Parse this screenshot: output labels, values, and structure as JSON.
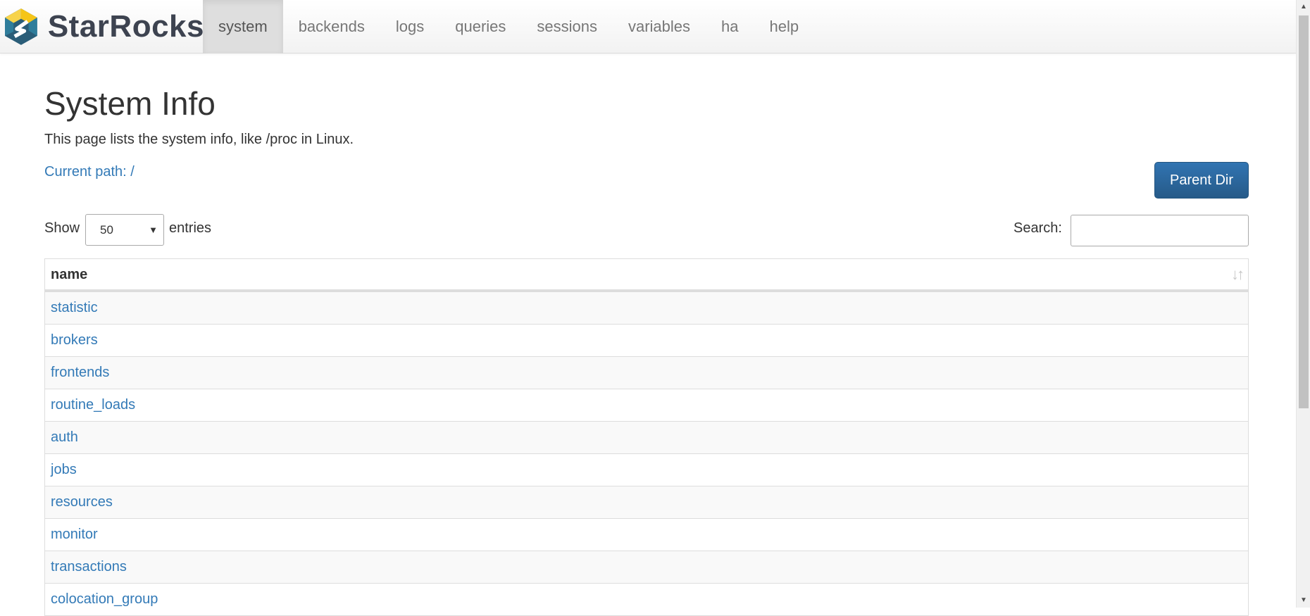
{
  "brand": {
    "name": "StarRocks"
  },
  "nav": {
    "items": [
      {
        "label": "system",
        "active": true
      },
      {
        "label": "backends"
      },
      {
        "label": "logs"
      },
      {
        "label": "queries"
      },
      {
        "label": "sessions"
      },
      {
        "label": "variables"
      },
      {
        "label": "ha"
      },
      {
        "label": "help"
      }
    ]
  },
  "page": {
    "title": "System Info",
    "description": "This page lists the system info, like /proc in Linux.",
    "current_path": "Current path: /",
    "parent_button": "Parent Dir"
  },
  "controls": {
    "show_label": "Show",
    "entries_value": "50",
    "entries_label": "entries",
    "search_label": "Search:",
    "search_value": ""
  },
  "table": {
    "header": "name",
    "rows": [
      "statistic",
      "brokers",
      "frontends",
      "routine_loads",
      "auth",
      "jobs",
      "resources",
      "monitor",
      "transactions",
      "colocation_group"
    ]
  },
  "colors": {
    "link": "#337ab7",
    "button": "#265a88",
    "nav_active_bg": "#dedede"
  },
  "icons": {
    "select_caret": "caret-down-icon",
    "sort": "sort-icon",
    "logo": "starrocks-logo"
  }
}
